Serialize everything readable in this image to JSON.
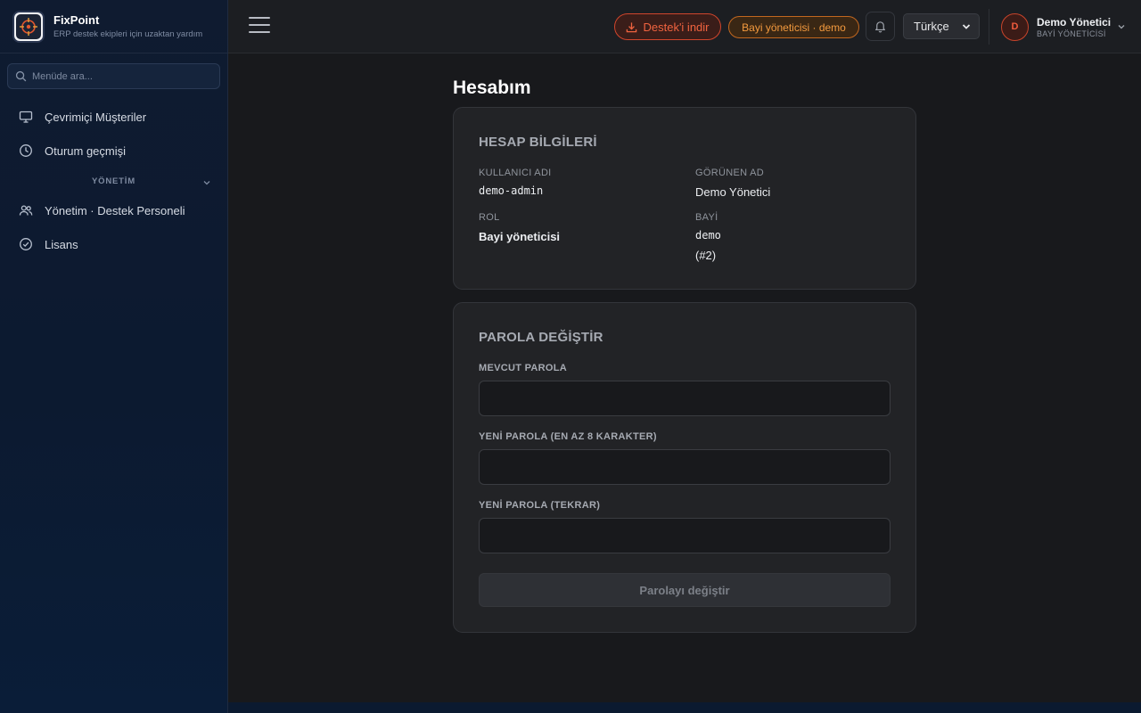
{
  "brand": {
    "title": "FixPoint",
    "subtitle": "ERP destek ekipleri için uzaktan yardım",
    "logo_icon": "crosshair-logo-icon"
  },
  "sidebar": {
    "search_placeholder": "Menüde ara...",
    "items": [
      {
        "label": "Çevrimiçi Müşteriler",
        "icon": "monitor-icon"
      },
      {
        "label": "Oturum geçmişi",
        "icon": "clock-icon"
      }
    ],
    "section_label": "YÖNETİM",
    "admin_items": [
      {
        "label": "Yönetim · Destek Personeli",
        "icon": "users-icon"
      },
      {
        "label": "Lisans",
        "icon": "check-circle-icon"
      }
    ]
  },
  "header": {
    "download_label": "Destek'i indir",
    "role_badge": "Bayi yöneticisi · demo",
    "language": "Türkçe",
    "user": {
      "initial": "D",
      "name": "Demo Yönetici",
      "role": "BAYİ YÖNETİCİSİ"
    }
  },
  "page": {
    "title": "Hesabım"
  },
  "account": {
    "heading": "HESAP BİLGİLERİ",
    "username_label": "KULLANICI ADI",
    "username_value": "demo-admin",
    "display_name_label": "GÖRÜNEN AD",
    "display_name_value": "Demo Yönetici",
    "role_label": "ROL",
    "role_value": "Bayi yöneticisi",
    "dealer_label": "BAYİ",
    "dealer_value": "demo",
    "dealer_id": "(#2)"
  },
  "password": {
    "heading": "PAROLA DEĞİŞTİR",
    "current_label": "MEVCUT PAROLA",
    "new_label": "YENİ PAROLA (EN AZ 8 KARAKTER)",
    "repeat_label": "YENİ PAROLA (TEKRAR)",
    "current_value": "",
    "new_value": "",
    "repeat_value": "",
    "submit_label": "Parolayı değiştir"
  },
  "colors": {
    "accent_red": "#f0633f",
    "accent_orange": "#f39a3e",
    "sidebar_bg": "#0f1b30",
    "content_bg": "#18191c"
  }
}
